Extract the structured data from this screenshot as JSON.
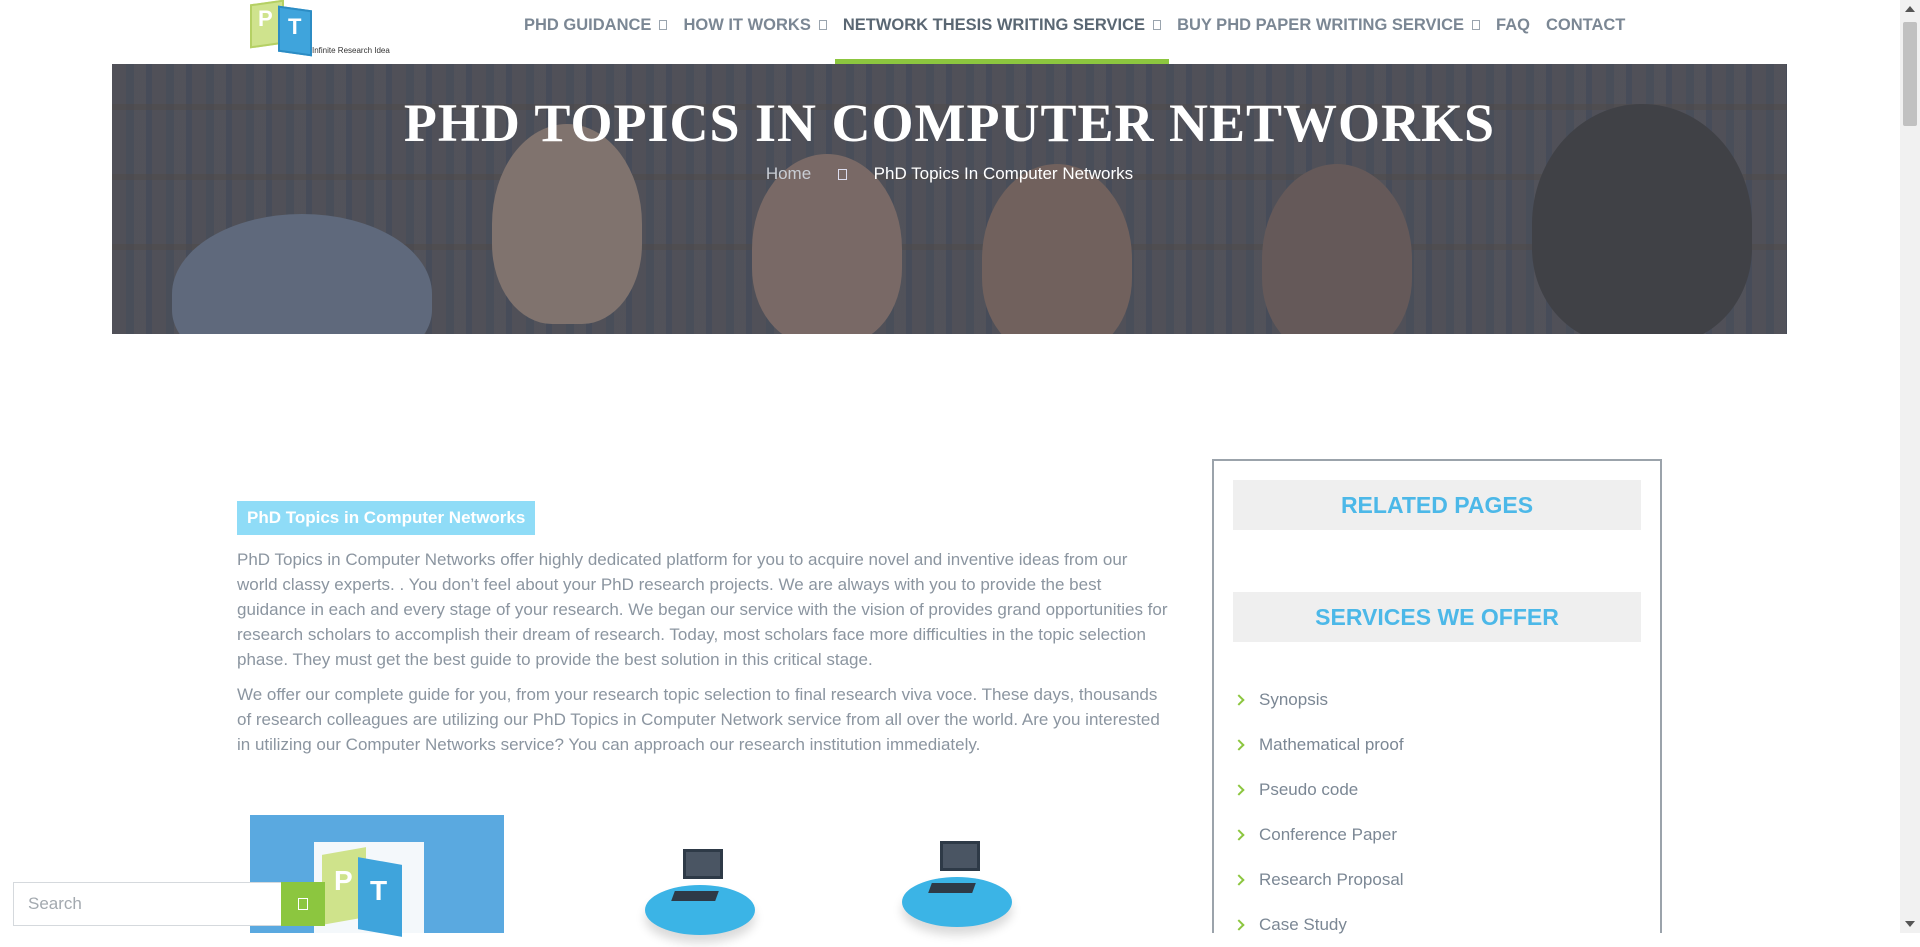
{
  "header": {
    "logo_tagline": "Infinite Research Idea",
    "logo_letter_p": "P",
    "logo_letter_t": "T",
    "nav": [
      {
        "label": "PHD GUIDANCE",
        "has_dropdown": true
      },
      {
        "label": "HOW IT WORKS",
        "has_dropdown": true
      },
      {
        "label": "NETWORK THESIS WRITING SERVICE",
        "has_dropdown": true,
        "active": true
      },
      {
        "label": "BUY PHD PAPER WRITING SERVICE",
        "has_dropdown": true
      },
      {
        "label": "FAQ",
        "has_dropdown": false
      },
      {
        "label": "CONTACT",
        "has_dropdown": false
      }
    ]
  },
  "hero": {
    "title": "PHD TOPICS IN COMPUTER NETWORKS",
    "breadcrumb_home": "Home",
    "breadcrumb_current": "PhD Topics In Computer Networks"
  },
  "main": {
    "heading": "PhD Topics in Computer Networks",
    "paragraphs": [
      "PhD Topics in Computer Networks offer highly dedicated platform for you to acquire novel and inventive ideas from our world classy experts. .  You don’t feel about your PhD research projects. We are always with you to provide the best guidance in each and every stage of your research. We began our service with the vision of provides grand opportunities for research scholars to accomplish their dream of research. Today, most scholars face more difficulties in the topic selection phase. They must get the best guide to provide the best solution in this critical stage.",
      "We offer our complete guide for you, from your research topic selection to final research viva voce. These days, thousands of research colleagues are utilizing our PhD Topics in Computer Network service from all over the world. Are you interested in utilizing our Computer Networks service? You can approach our research institution immediately."
    ]
  },
  "sidebar": {
    "related_title": "RELATED PAGES",
    "services_title": "SERVICES WE OFFER",
    "services": [
      "Synopsis",
      "Mathematical proof",
      "Pseudo code",
      "Conference Paper",
      "Research Proposal",
      "Case Study"
    ]
  },
  "search": {
    "placeholder": "Search"
  },
  "colors": {
    "accent_green": "#8cc63f",
    "accent_blue": "#4cb8e8",
    "heading_badge": "#8fdcf7",
    "text_gray": "#8b95a0"
  },
  "icons": [
    "dropdown-caret-icon",
    "breadcrumb-separator-icon",
    "chevron-right-icon",
    "search-icon"
  ]
}
